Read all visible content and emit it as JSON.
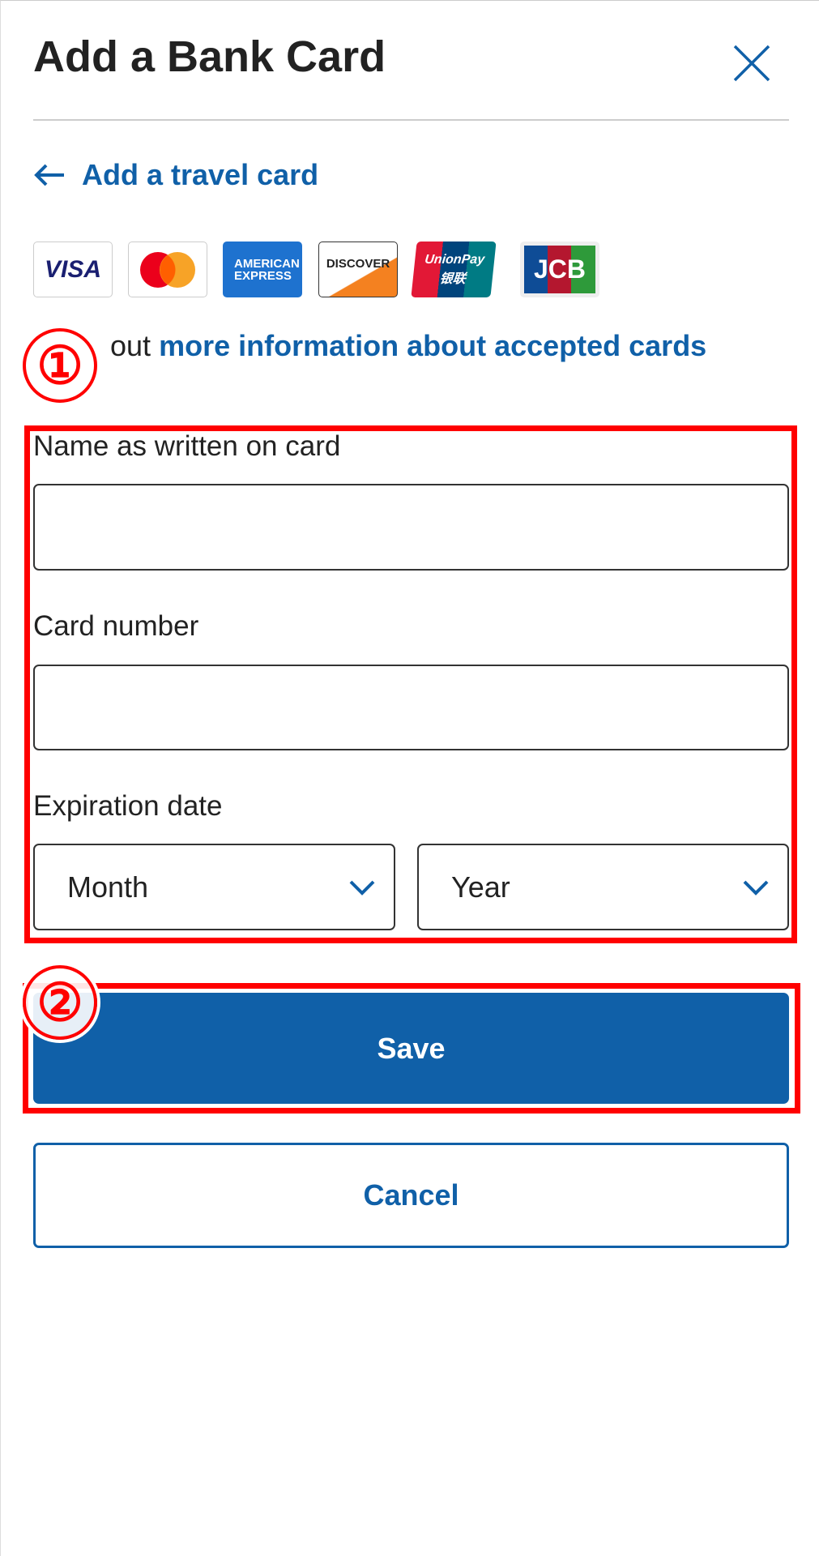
{
  "header": {
    "title": "Add a Bank Card",
    "close_icon": "close-icon"
  },
  "back_link": {
    "label": "Add a travel card",
    "icon": "arrow-left-icon"
  },
  "cards": [
    {
      "name": "VISA"
    },
    {
      "name": "Mastercard"
    },
    {
      "name": "AMERICAN EXPRESS"
    },
    {
      "name": "DISCOVER"
    },
    {
      "name": "UnionPay 银联"
    },
    {
      "name": "JCB"
    }
  ],
  "info": {
    "prefix": "out",
    "link": "more information about accepted cards"
  },
  "form": {
    "name_label": "Name as written on card",
    "name_value": "",
    "number_label": "Card number",
    "number_value": "",
    "expiry_label": "Expiration date",
    "month": "Month",
    "year": "Year"
  },
  "annotations": {
    "one": "①",
    "two": "②",
    "color": "#ff0000"
  },
  "buttons": {
    "save": "Save",
    "cancel": "Cancel"
  },
  "colors": {
    "primary": "#1060a8"
  }
}
